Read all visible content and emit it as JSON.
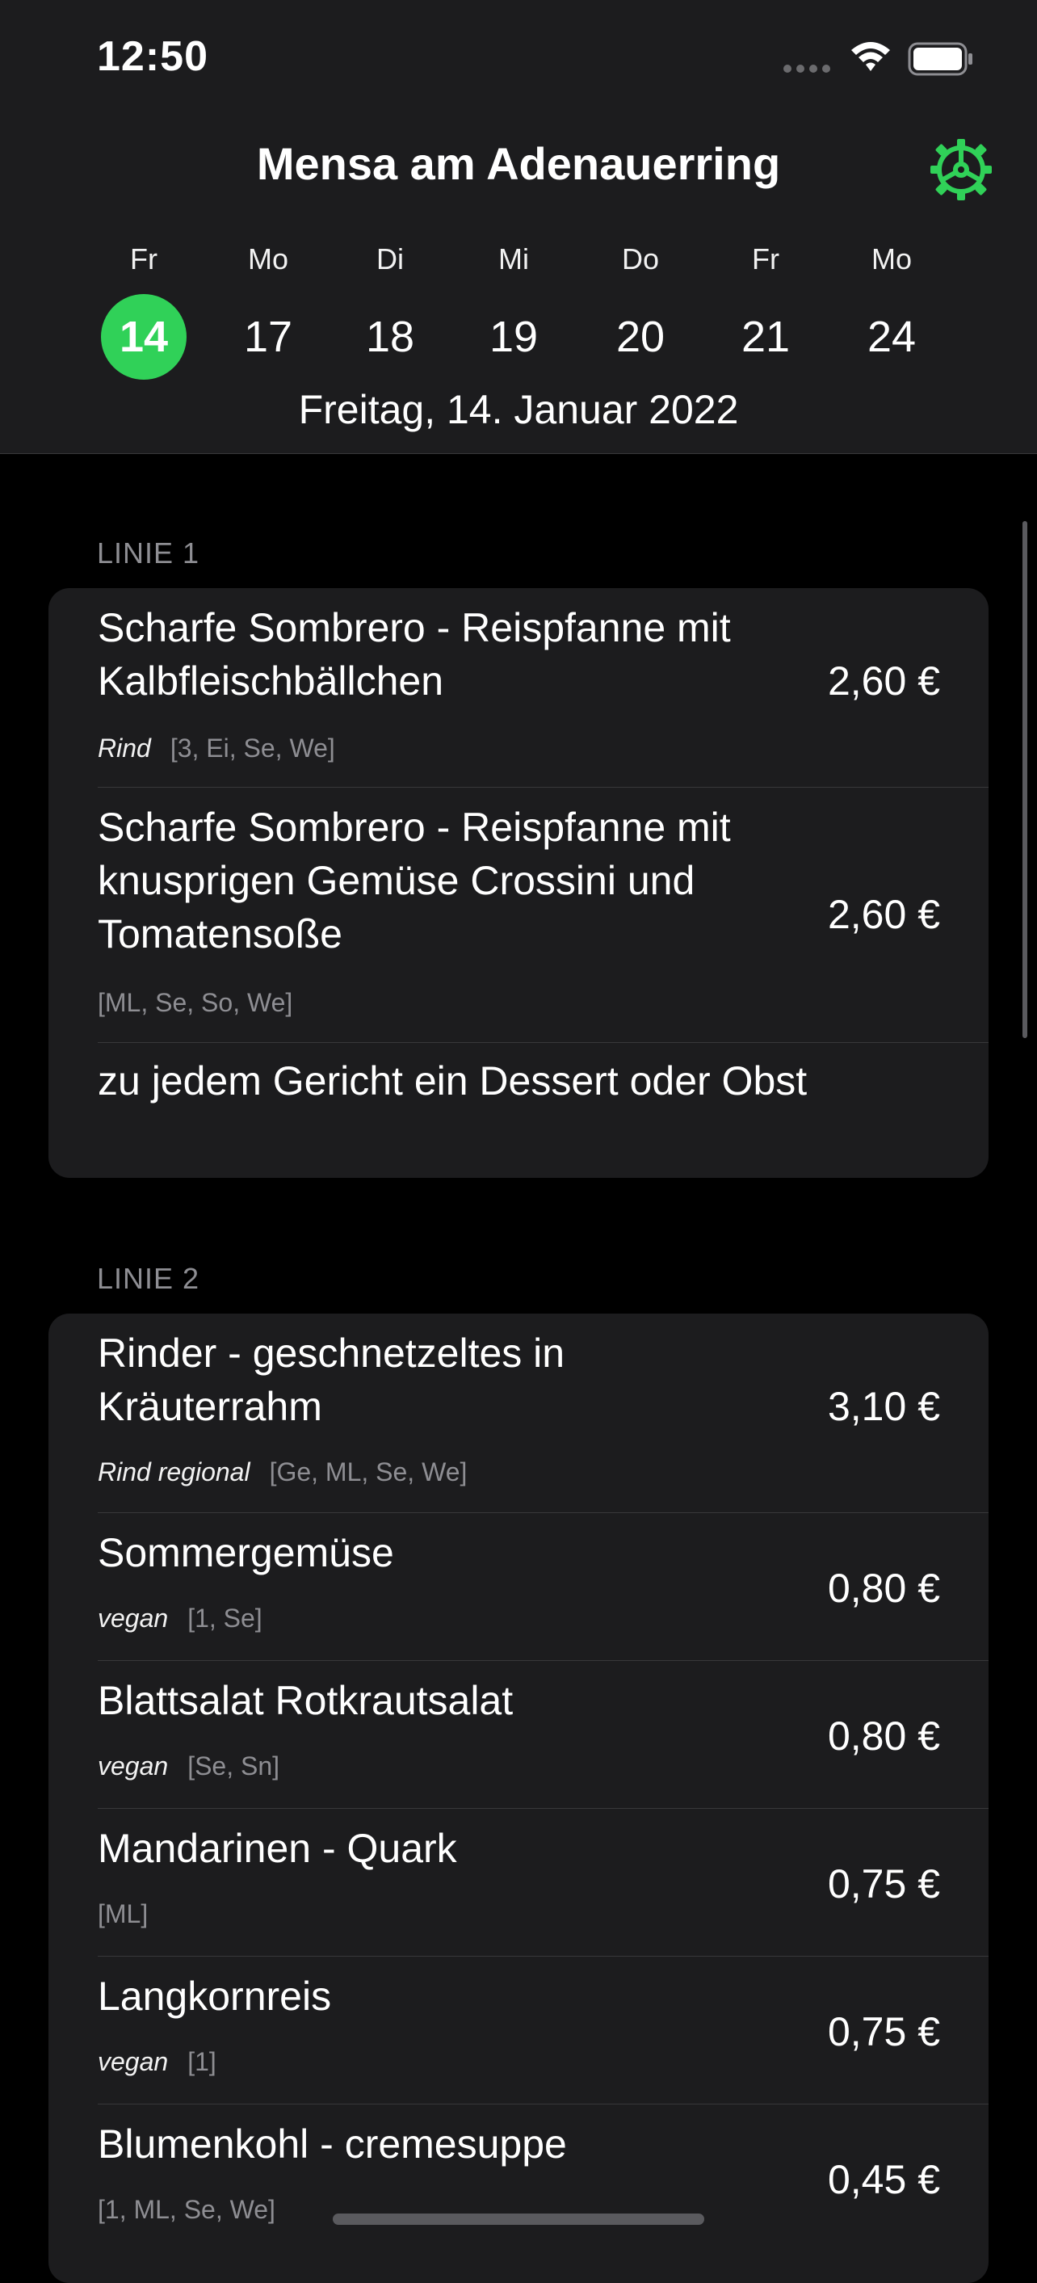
{
  "status_bar": {
    "time": "12:50"
  },
  "nav": {
    "title": "Mensa am Adenauerring",
    "settings_icon": "gear-icon"
  },
  "days": [
    {
      "name": "Fr",
      "num": "14",
      "selected": true
    },
    {
      "name": "Mo",
      "num": "17"
    },
    {
      "name": "Di",
      "num": "18"
    },
    {
      "name": "Mi",
      "num": "19"
    },
    {
      "name": "Do",
      "num": "20"
    },
    {
      "name": "Fr",
      "num": "21"
    },
    {
      "name": "Mo",
      "num": "24"
    }
  ],
  "selected_date": "Freitag, 14. Januar 2022",
  "accent_color": "#30d158",
  "sections": [
    {
      "header": "LINIE 1",
      "items": [
        {
          "title_lines": [
            "Scharfe Sombrero - Reispfanne mit",
            "Kalbfleischbällchen"
          ],
          "tag": "Rind",
          "allergens": "[3, Ei, Se, We]",
          "price": "2,60 €"
        },
        {
          "title_lines": [
            "Scharfe Sombrero - Reispfanne mit",
            "knusprigen Gemüse Crossini und",
            "Tomatensoße"
          ],
          "tag": "",
          "allergens": "[ML, Se, So, We]",
          "price": "2,60 €"
        },
        {
          "title_lines": [
            "zu jedem Gericht ein Dessert oder Obst"
          ],
          "tag": "",
          "allergens": "",
          "price": ""
        }
      ]
    },
    {
      "header": "LINIE 2",
      "items": [
        {
          "title_lines": [
            "Rinder - geschnetzeltes in",
            "Kräuterrahm"
          ],
          "tag": "Rind regional",
          "allergens": "[Ge, ML, Se, We]",
          "price": "3,10 €"
        },
        {
          "title_lines": [
            "Sommergemüse"
          ],
          "tag": "vegan",
          "allergens": "[1, Se]",
          "price": "0,80 €"
        },
        {
          "title_lines": [
            "Blattsalat Rotkrautsalat"
          ],
          "tag": "vegan",
          "allergens": "[Se, Sn]",
          "price": "0,80 €"
        },
        {
          "title_lines": [
            "Mandarinen - Quark"
          ],
          "tag": "",
          "allergens": "[ML]",
          "price": "0,75 €"
        },
        {
          "title_lines": [
            "Langkornreis"
          ],
          "tag": "vegan",
          "allergens": "[1]",
          "price": "0,75 €"
        },
        {
          "title_lines": [
            "Blumenkohl - cremesuppe"
          ],
          "tag": "",
          "allergens": "[1, ML, Se, We]",
          "price": "0,45 €"
        }
      ]
    }
  ]
}
